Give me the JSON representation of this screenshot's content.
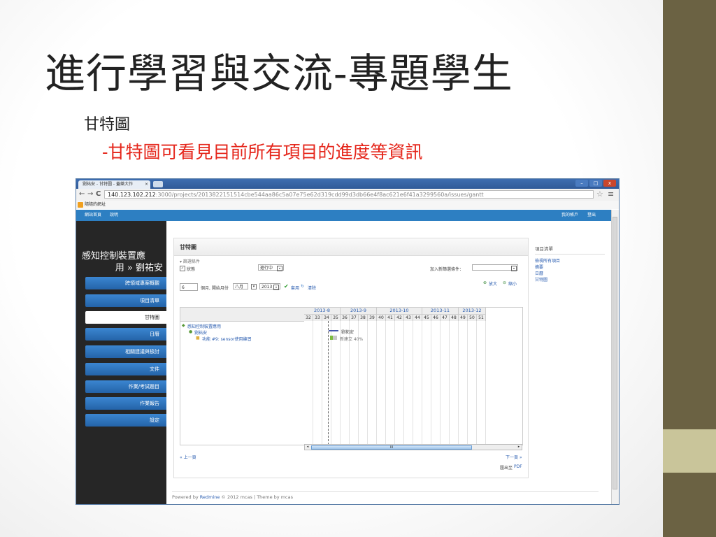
{
  "slide": {
    "title": "進行學習與交流-專題學生",
    "subtitle": "甘特圖",
    "bullet": "-甘特圖可看見目前所有項目的進度等資訊"
  },
  "browser": {
    "tab_title": "劉祐安 - 甘特圖 - 蓋樂大作",
    "tab_close": "×",
    "url_host": "140.123.102.212",
    "url_path": ":3000/projects/2013822151514cbe544aa86c5a07e75e62d319cdd99d3db66e4f8ac621e6f41a3299560a/issues/gantt",
    "bookmark": "隨隨的網址",
    "back": "←",
    "forward": "→",
    "reload": "C",
    "star": "☆",
    "menu": "≡",
    "win_min": "–",
    "win_max": "□",
    "win_close": "x"
  },
  "topnav": {
    "home": "網站首頁",
    "help": "說明",
    "my_account": "我的帳戶",
    "logout": "登出"
  },
  "sidebar": {
    "project_title_l1": "感知控制裝置應",
    "project_title_l2": "用 » 劉祐安",
    "items": [
      {
        "label": "跨領域專案概觀"
      },
      {
        "label": "項目清單"
      },
      {
        "label": "甘特圖"
      },
      {
        "label": "日曆"
      },
      {
        "label": "相關建議與檢討"
      },
      {
        "label": "文件"
      },
      {
        "label": "作業/考試題目"
      },
      {
        "label": "作業報告"
      },
      {
        "label": "設定"
      }
    ]
  },
  "gantt": {
    "heading": "甘特圖",
    "filter_legend": "▾ 篩選條件",
    "filter_status_label": "狀態",
    "filter_status_value": "進行中",
    "add_filter_label": "加入新篩選條件：",
    "months_count": "6",
    "months_label": "個月, 開始月份",
    "month_value": "八月",
    "year_value": "2013",
    "apply": "套用",
    "clear": "清除",
    "zoom_in": "放大",
    "zoom_out": "縮小",
    "months": [
      "2013-8",
      "2013-9",
      "2013-10",
      "2013-11",
      "2013-12"
    ],
    "weeks": [
      "32",
      "33",
      "34",
      "35",
      "36",
      "37",
      "38",
      "39",
      "40",
      "41",
      "42",
      "43",
      "44",
      "45",
      "46",
      "47",
      "48",
      "49",
      "50",
      "51"
    ],
    "tree_project": "感知控制裝置應用",
    "tree_user": "劉祐安",
    "tree_issue": "功能 #9: sensor使用練習",
    "bar_user_label": "劉祐安",
    "bar_issue_label": "新建立 40%",
    "progress_percent": 40,
    "prev": "« 上一頁",
    "next": "下一頁 »",
    "export_label": "匯出至",
    "export_pdf": "PDF",
    "scroll_grip": "III",
    "scroll_left": "◂",
    "scroll_right": "▸"
  },
  "right_panel": {
    "heading": "項目清單",
    "links": [
      "檢視所有項目",
      "摘要",
      "日曆",
      "甘特圖"
    ]
  },
  "footer": {
    "prefix": "Powered by ",
    "link": "Redmine",
    "suffix": " © 2012 mcas | Theme by mcas"
  },
  "colors": {
    "accent": "#2d7fc2",
    "bullet": "#e5261b",
    "side_dark": "#6b6243",
    "side_light": "#c9c59a"
  }
}
